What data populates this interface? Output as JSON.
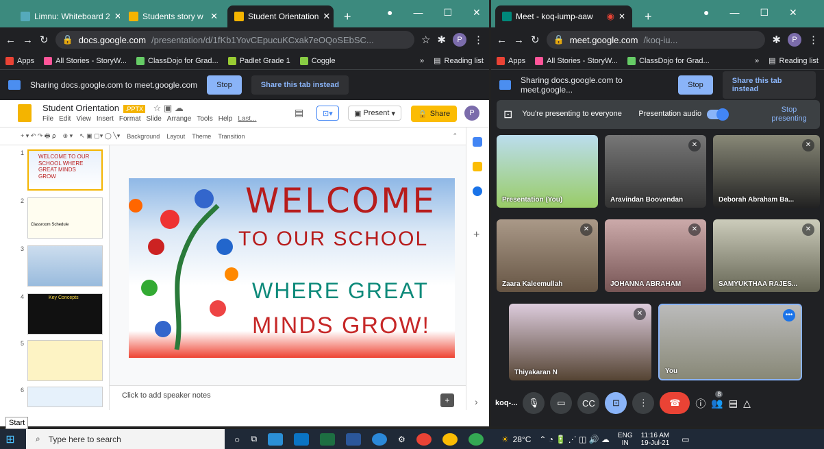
{
  "left_window": {
    "tabs": [
      {
        "label": "Limnu: Whiteboard 2"
      },
      {
        "label": "Students story w"
      },
      {
        "label": "Student Orientation"
      }
    ],
    "url_host": "docs.google.com",
    "url_path": "/presentation/d/1fKb1YovCEpucuKCxak7eOQoSEbSC...",
    "bookmarks": [
      "Apps",
      "All Stories - StoryW...",
      "ClassDojo for Grad...",
      "Padlet Grade 1",
      "Coggle"
    ],
    "reading_list": "Reading list",
    "sharing_text": "Sharing docs.google.com to meet.google.com",
    "stop": "Stop",
    "share_instead": "Share this tab instead",
    "doc_title": "Student Orientation",
    "doc_badge": ".PPTX",
    "menus": [
      "File",
      "Edit",
      "View",
      "Insert",
      "Format",
      "Slide",
      "Arrange",
      "Tools",
      "Help",
      "Last..."
    ],
    "present": "Present",
    "share": "Share",
    "avatar": "P",
    "toolbar": [
      "Background",
      "Layout",
      "Theme",
      "Transition"
    ],
    "thumb_numbers": [
      "1",
      "2",
      "3",
      "4",
      "5",
      "6"
    ],
    "thumb1_text": "WELCOME TO OUR SCHOOL WHERE GREAT MINDS GROW",
    "thumb2_text": "Classroom Schedule",
    "thumb4_text": "Key Concepts",
    "slide_line1": "WELCOME",
    "slide_line2": "TO OUR SCHOOL",
    "slide_line3": "WHERE GREAT",
    "slide_line4": "MINDS GROW!",
    "speaker_notes": "Click to add speaker notes"
  },
  "right_window": {
    "tab": "Meet - koq-iump-aaw",
    "url_host": "meet.google.com",
    "url_path": "/koq-iu...",
    "bookmarks": [
      "Apps",
      "All Stories - StoryW...",
      "ClassDojo for Grad..."
    ],
    "reading_list": "Reading list",
    "sharing_text": "Sharing docs.google.com to meet.google...",
    "stop": "Stop",
    "share_instead": "Share this tab instead",
    "presenting": "You're presenting to everyone",
    "audio": "Presentation audio",
    "stop_presenting": "Stop presenting",
    "participants": [
      "Presentation (You)",
      "Aravindan Boovendan",
      "Deborah Abraham Ba...",
      "Zaara Kaleemullah",
      "JOHANNA ABRAHAM",
      "SAMYUKTHAA RAJES...",
      "Thiyakaran N",
      "You"
    ],
    "meeting_code": "koq-...",
    "people_count": "8"
  },
  "taskbar": {
    "search_placeholder": "Type here to search",
    "weather": "28°C",
    "lang1": "ENG",
    "lang2": "IN",
    "time": "11:16 AM",
    "date": "19-Jul-21",
    "start_tip": "Start"
  }
}
